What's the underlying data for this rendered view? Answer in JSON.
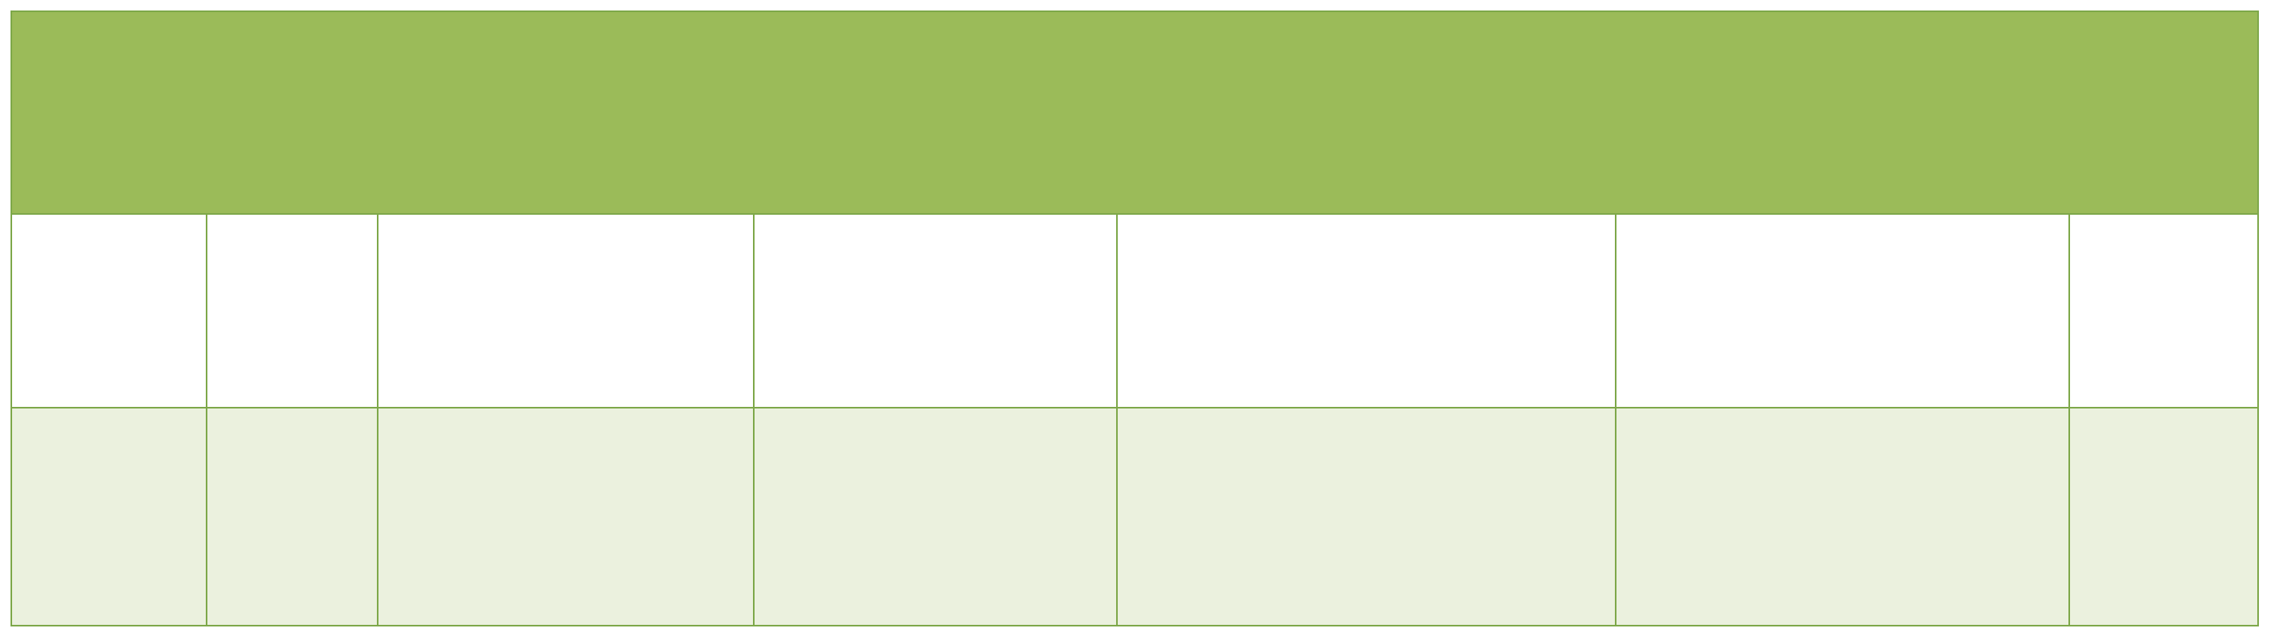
{
  "table": {
    "colors": {
      "header_fill": "#9bbb59",
      "border": "#7ea84a",
      "band_fill": "#ebf1de",
      "plain_fill": "#ffffff"
    },
    "header": [
      "",
      "",
      "",
      "",
      "",
      "",
      ""
    ],
    "rows": [
      [
        "",
        "",
        "",
        "",
        "",
        "",
        ""
      ],
      [
        "",
        "",
        "",
        "",
        "",
        "",
        ""
      ]
    ]
  }
}
